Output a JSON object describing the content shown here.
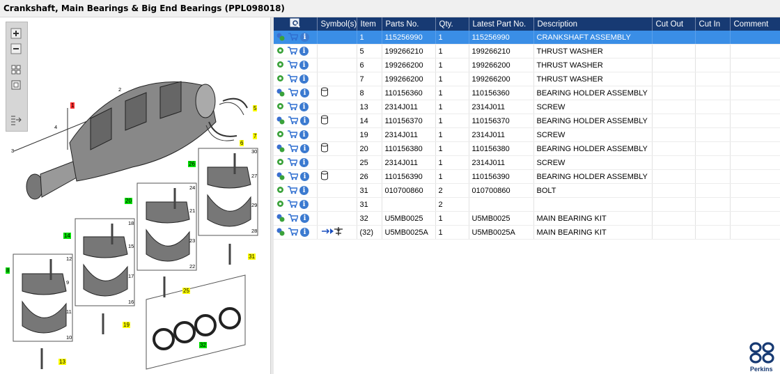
{
  "window": {
    "title": "Crankshaft, Main Bearings & Big End Bearings (PPL098018)"
  },
  "toolbar": {
    "buttons": [
      "zoom-in-icon",
      "zoom-out-icon",
      "fit-icon",
      "reset-icon",
      "export-icon"
    ]
  },
  "table": {
    "headers": [
      "",
      "Symbol(s)",
      "Item",
      "Parts No.",
      "Qty.",
      "Latest Part No.",
      "Description",
      "Cut Out",
      "Cut In",
      "Comment"
    ],
    "rows": [
      {
        "item": "1",
        "part": "115256990",
        "qty": "1",
        "latest": "115256990",
        "desc": "CRANKSHAFT ASSEMBLY",
        "symbol": "",
        "selected": true,
        "assembly": true
      },
      {
        "item": "5",
        "part": "199266210",
        "qty": "1",
        "latest": "199266210",
        "desc": "THRUST WASHER",
        "symbol": "",
        "selected": false,
        "assembly": false
      },
      {
        "item": "6",
        "part": "199266200",
        "qty": "1",
        "latest": "199266200",
        "desc": "THRUST WASHER",
        "symbol": "",
        "selected": false,
        "assembly": false
      },
      {
        "item": "7",
        "part": "199266200",
        "qty": "1",
        "latest": "199266200",
        "desc": "THRUST WASHER",
        "symbol": "",
        "selected": false,
        "assembly": false
      },
      {
        "item": "8",
        "part": "110156360",
        "qty": "1",
        "latest": "110156360",
        "desc": "BEARING HOLDER ASSEMBLY",
        "symbol": "cylinder",
        "selected": false,
        "assembly": true
      },
      {
        "item": "13",
        "part": "2314J011",
        "qty": "1",
        "latest": "2314J011",
        "desc": "SCREW",
        "symbol": "",
        "selected": false,
        "assembly": false
      },
      {
        "item": "14",
        "part": "110156370",
        "qty": "1",
        "latest": "110156370",
        "desc": "BEARING HOLDER ASSEMBLY",
        "symbol": "cylinder",
        "selected": false,
        "assembly": true
      },
      {
        "item": "19",
        "part": "2314J011",
        "qty": "1",
        "latest": "2314J011",
        "desc": "SCREW",
        "symbol": "",
        "selected": false,
        "assembly": false
      },
      {
        "item": "20",
        "part": "110156380",
        "qty": "1",
        "latest": "110156380",
        "desc": "BEARING HOLDER ASSEMBLY",
        "symbol": "cylinder",
        "selected": false,
        "assembly": true
      },
      {
        "item": "25",
        "part": "2314J011",
        "qty": "1",
        "latest": "2314J011",
        "desc": "SCREW",
        "symbol": "",
        "selected": false,
        "assembly": false
      },
      {
        "item": "26",
        "part": "110156390",
        "qty": "1",
        "latest": "110156390",
        "desc": "BEARING HOLDER ASSEMBLY",
        "symbol": "cylinder",
        "selected": false,
        "assembly": true
      },
      {
        "item": "31",
        "part": "010700860",
        "qty": "2",
        "latest": "010700860",
        "desc": "BOLT",
        "symbol": "",
        "selected": false,
        "assembly": false
      },
      {
        "item": "31",
        "part": "",
        "qty": "2",
        "latest": "",
        "desc": "",
        "symbol": "",
        "selected": false,
        "assembly": false
      },
      {
        "item": "32",
        "part": "U5MB0025",
        "qty": "1",
        "latest": "U5MB0025",
        "desc": "MAIN BEARING KIT",
        "symbol": "",
        "selected": false,
        "assembly": true
      },
      {
        "item": "(32)",
        "part": "U5MB0025A",
        "qty": "1",
        "latest": "U5MB0025A",
        "desc": "MAIN BEARING KIT",
        "symbol": "alternative",
        "selected": false,
        "assembly": true
      }
    ]
  },
  "diagram": {
    "callouts": [
      {
        "label": "1",
        "color": "red"
      },
      {
        "label": "5",
        "color": "yellow"
      },
      {
        "label": "7",
        "color": "yellow"
      },
      {
        "label": "6",
        "color": "yellow"
      },
      {
        "label": "26",
        "color": "green"
      },
      {
        "label": "20",
        "color": "green"
      },
      {
        "label": "14",
        "color": "green"
      },
      {
        "label": "8",
        "color": "green"
      },
      {
        "label": "31",
        "color": "yellow"
      },
      {
        "label": "25",
        "color": "yellow"
      },
      {
        "label": "19",
        "color": "yellow"
      },
      {
        "label": "13",
        "color": "yellow"
      },
      {
        "label": "32",
        "color": "green"
      }
    ],
    "numbers": [
      "2",
      "3",
      "4",
      "30",
      "27",
      "29",
      "28",
      "24",
      "21",
      "23",
      "22",
      "18",
      "15",
      "17",
      "16",
      "12",
      "9",
      "11",
      "10"
    ]
  },
  "brand": {
    "name": "Perkins",
    "color": "#173a73"
  },
  "colors": {
    "header": "#173a73",
    "selected": "#3a8ee6",
    "highlight_yellow": "#ffff00",
    "highlight_green": "#00e000",
    "highlight_red": "#ff3030"
  }
}
